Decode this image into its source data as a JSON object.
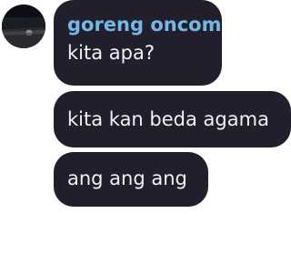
{
  "avatar": {
    "icon": "user-avatar-icon"
  },
  "messages": [
    {
      "sender": "goreng oncom",
      "text": "kita apa?"
    },
    {
      "text": "kita kan beda agama"
    },
    {
      "text": "ang ang ang"
    }
  ],
  "colors": {
    "bubble": "#221f2c",
    "sender_name": "#74b8e7",
    "text": "#f2f0f5",
    "background": "#ffffff"
  }
}
